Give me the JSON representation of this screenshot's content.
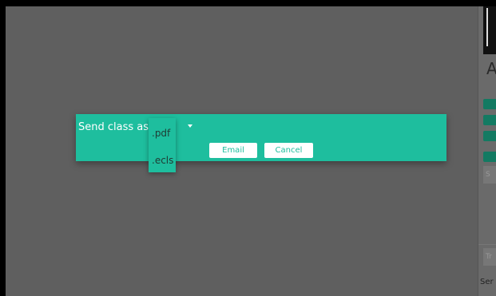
{
  "background": {
    "overlay_color": "#5f5f5f"
  },
  "right_panel": {
    "visible_letter": "A",
    "visible_field_text": "S",
    "visible_field2_text": "Tr",
    "visible_footer_text": "Ser",
    "accent_color": "#137a62"
  },
  "dialog": {
    "label": "Send class as:",
    "buttons": {
      "email": "Email",
      "cancel": "Cancel"
    },
    "accent_color": "#1ebe9e"
  },
  "dropdown": {
    "options": [
      ".pdf",
      ".ecls"
    ]
  }
}
